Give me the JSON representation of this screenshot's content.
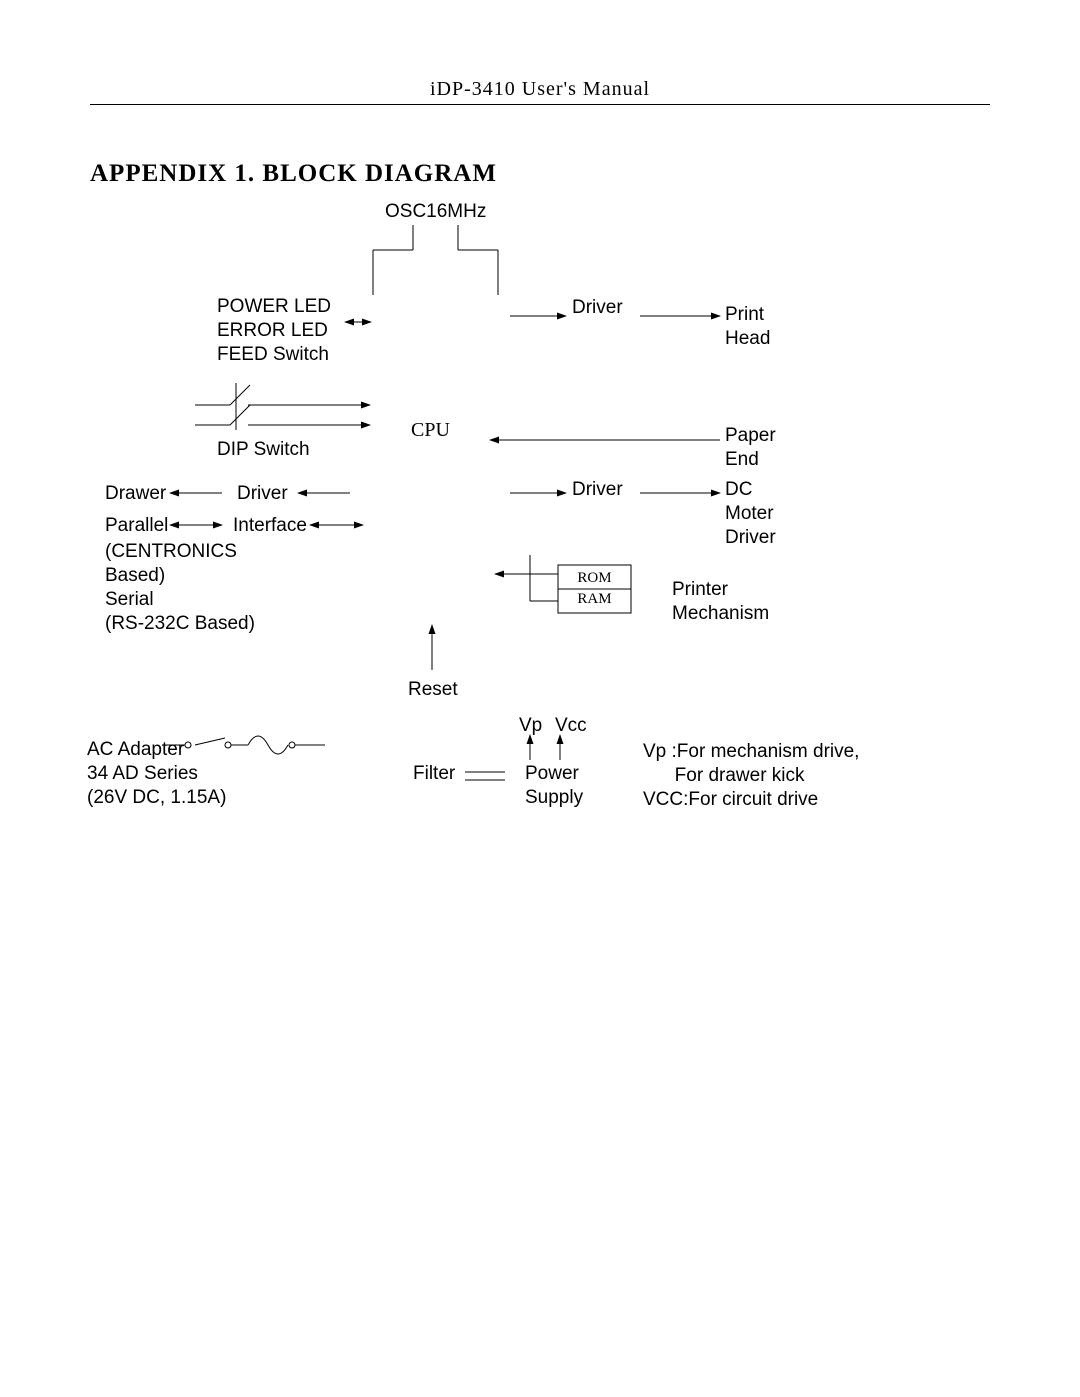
{
  "header": {
    "title": "iDP-3410 User's Manual"
  },
  "title": "APPENDIX 1.    BLOCK DIAGRAM",
  "diagram": {
    "osc": "OSC16MHz",
    "leds": "POWER LED\nERROR LED\nFEED Switch",
    "driver1": "Driver",
    "print_head": "Print\nHead",
    "dip": "DIP Switch",
    "cpu": "CPU",
    "paper_end": "Paper\nEnd",
    "drawer": "Drawer",
    "driver2": "Driver",
    "driver3": "Driver",
    "dc_motor": "DC\nMoter\nDriver",
    "parallel": "Parallel",
    "interface": "Interface",
    "centronics": "(CENTRONICS\nBased)\nSerial\n(RS-232C Based)",
    "rom": "ROM",
    "ram": "RAM",
    "printer_mech": "Printer\nMechanism",
    "reset": "Reset",
    "vp": "Vp",
    "vcc": "Vcc",
    "ac_adapter": "AC Adapter\n34 AD Series\n(26V DC, 1.15A)",
    "filter": "Filter",
    "power_supply": "Power\nSupply",
    "notes": "Vp :For mechanism drive,\n      For drawer kick\nVCC:For circuit drive"
  }
}
